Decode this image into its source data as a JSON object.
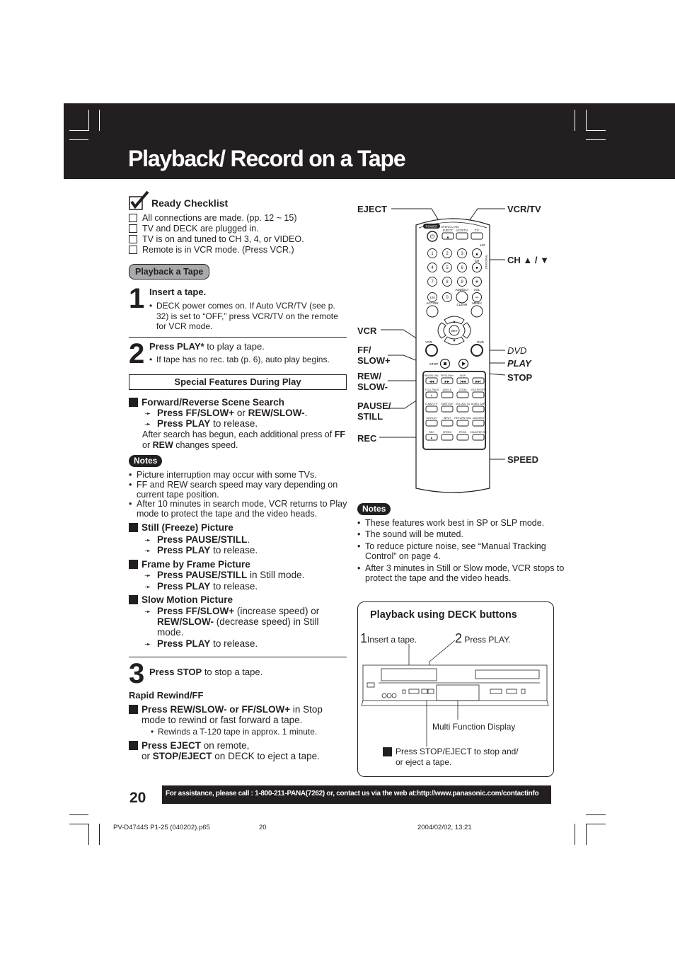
{
  "header": {
    "title": "Playback/ Record on a Tape"
  },
  "checklist": {
    "title": "Ready Checklist",
    "items": [
      "All connections are made. (pp. 12 ~ 15)",
      "TV and DECK are plugged in.",
      "TV is on and tuned to CH 3, 4, or VIDEO.",
      "Remote is in VCR mode. (Press VCR.)"
    ]
  },
  "section_pill": "Playback a Tape",
  "step1": {
    "num": "1",
    "head": "Insert a tape.",
    "bullet": "DECK power comes on. If Auto VCR/TV (see p. 32) is set to “OFF,” press VCR/TV on the remote for VCR mode."
  },
  "step2": {
    "num": "2",
    "head_bold": "Press PLAY*",
    "head_rest": " to play a tape.",
    "bullet": "If tape has no rec. tab (p. 6), auto play begins."
  },
  "special_features": {
    "title": "Special Features During Play",
    "search": {
      "title": "Forward/Reverse Scene Search",
      "line1_bold_a": "Press FF/SLOW+",
      "line1_mid": " or ",
      "line1_bold_b": "REW/SLOW-",
      "line1_end": ".",
      "line2_bold": "Press PLAY",
      "line2_rest": " to release.",
      "after_a": "After search has begun, each additional press of ",
      "after_b1": "FF",
      "after_b2": " or ",
      "after_b3": "REW",
      "after_b4": " changes speed."
    },
    "notes_label": "Notes",
    "notes": [
      "Picture interruption may occur with some TVs.",
      "FF and REW search speed may vary depending on current tape position.",
      "After 10 minutes in search mode, VCR returns to Play mode to protect the tape and the video heads."
    ],
    "still": {
      "title": "Still (Freeze) Picture",
      "line1_bold": "Press PAUSE/STILL",
      "line1_rest": ".",
      "line2_bold": "Press PLAY",
      "line2_rest": " to release."
    },
    "frame": {
      "title": "Frame by Frame Picture",
      "line1_bold": "Press PAUSE/STILL",
      "line1_rest": " in Still mode.",
      "line2_bold": "Press PLAY",
      "line2_rest": " to release."
    },
    "slow": {
      "title": "Slow Motion Picture",
      "line1_bold": "Press FF/SLOW+",
      "line1_rest": " (increase speed) or",
      "line2_bold": "REW/SLOW-",
      "line2_rest": " (decrease speed) in Still",
      "line3": "mode.",
      "line4_bold": "Press PLAY",
      "line4_rest": " to release."
    }
  },
  "step3": {
    "num": "3",
    "head_bold": "Press STOP",
    "head_rest": " to stop a tape."
  },
  "rapid": {
    "title": "Rapid Rewind/FF",
    "item1_bold": "Press REW/SLOW- or FF/SLOW+",
    "item1_rest": " in Stop",
    "item1_line2": "mode to rewind or fast forward a tape.",
    "item1_bullet": "Rewinds a T-120 tape in approx. 1 minute.",
    "item2_bold": "Press EJECT",
    "item2_rest": " on remote,",
    "item2_line2_a": "or ",
    "item2_line2_bold": "STOP/EJECT",
    "item2_line2_rest": " on DECK to eject a tape."
  },
  "remote": {
    "labels": {
      "eject": "EJECT",
      "vcrtv": "VCR/TV",
      "ch": "CH ▲ / ▼",
      "vcr": "VCR",
      "ff": "FF/\nSLOW+",
      "ff1": "FF/",
      "ff2": "SLOW+",
      "dvd": "DVD",
      "play": "PLAY",
      "rew1": "REW/",
      "rew2": "SLOW-",
      "stop": "STOP",
      "pause1": "PAUSE/",
      "pause2": "STILL",
      "rec": "REC",
      "speed": "SPEED"
    },
    "buttons": {
      "power": "POWER",
      "open_close": "OPEN/CLOSE",
      "eject": "EJECT",
      "vcrtv": "VCR/TV",
      "tv": "TV",
      "digits": [
        "1",
        "2",
        "3",
        "4",
        "5",
        "6",
        "7",
        "8",
        "9",
        "100",
        "0"
      ],
      "ge10": "≥10",
      "ch": "CH",
      "tracking": "TRACKING",
      "add_dlt": "ADD/DLT",
      "vol": "VOL",
      "action": "ACTION",
      "clear": "CLEAR",
      "menu": "MENU",
      "play_list": "PLAY LIST",
      "set": "SET",
      "vcr": "VCR",
      "dvd": "DVD",
      "stop": "STOP",
      "play": "PLAY",
      "rew_slow": "REW/SLOW-",
      "ff_slow": "FF/SLOW+",
      "skip": "SKIP",
      "still_pause": "STILL PAUSE",
      "angle": "ANGLE",
      "zoom": "ZOOM",
      "vss_enter": "VSS ENTER",
      "dtitle": "D.NAVI TITLE",
      "subtitle": "SUBTITLE",
      "vol_adj": "VOL.ADJ TAPE POS.",
      "audio": "AUDIO SAP/Hi-Fi",
      "display": "DISPLAY",
      "input": "INPUT",
      "return_search": "RETURN SEARCH",
      "cm_zero": "CM/ZERO",
      "rec": "REC",
      "speed": "SPEED",
      "prog": "PROG",
      "counter_reset": "COUNTER RESET"
    }
  },
  "notes2": {
    "label": "Notes",
    "items": [
      "These features work best in SP or SLP mode.",
      "The sound will be muted.",
      "To reduce picture noise, see “Manual Tracking Control” on page 4.",
      "After 3 minutes in Still or Slow mode, VCR stops to protect the tape and the video heads."
    ]
  },
  "deck": {
    "title": "Playback using DECK buttons",
    "step1_num": "1",
    "step1_text": "Insert a tape.",
    "step2_num": "2",
    "step2_text": "Press PLAY.",
    "display_label": "Multi Function Display",
    "stop_eject": "Press STOP/EJECT to stop and/ or eject a tape."
  },
  "footer": {
    "page_number": "20",
    "assistance": "For assistance, please call : 1-800-211-PANA(7262) or, contact us via the web at:http://www.panasonic.com/contactinfo",
    "file": "PV-D4744S P1-25 (040202).p65",
    "page": "20",
    "date": "2004/02/02, 13:21"
  }
}
